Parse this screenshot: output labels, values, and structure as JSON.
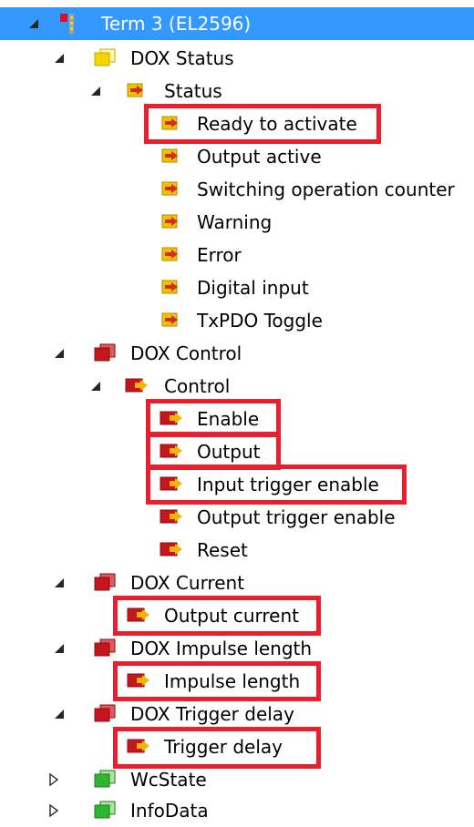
{
  "tree": {
    "term": {
      "label": "Term 3 (EL2596)"
    },
    "dox_status": {
      "label": "DOX Status"
    },
    "status": {
      "label": "Status"
    },
    "status_items": [
      "Ready to activate",
      "Output active",
      "Switching operation counter",
      "Warning",
      "Error",
      "Digital input",
      "TxPDO Toggle"
    ],
    "dox_control": {
      "label": "DOX Control"
    },
    "control": {
      "label": "Control"
    },
    "control_items": [
      "Enable",
      "Output",
      "Input trigger enable",
      "Output trigger enable",
      "Reset"
    ],
    "dox_current": {
      "label": "DOX Current",
      "child": "Output current"
    },
    "dox_impulse": {
      "label": "DOX Impulse length",
      "child": "Impulse length"
    },
    "dox_trigger": {
      "label": "DOX Trigger delay",
      "child": "Trigger delay"
    },
    "wcstate": {
      "label": "WcState"
    },
    "infodata": {
      "label": "InfoData"
    }
  },
  "colors": {
    "selection": "#3399ff",
    "highlight": "#e8202e",
    "input_icon": "#f2c200",
    "output_icon": "#c4161c",
    "info_icon": "#2fb52f"
  },
  "icons": {
    "expanded": "expanded-triangle-icon",
    "collapsed": "collapsed-triangle-icon",
    "input_var": "input-variable-icon",
    "output_var": "output-variable-icon"
  }
}
